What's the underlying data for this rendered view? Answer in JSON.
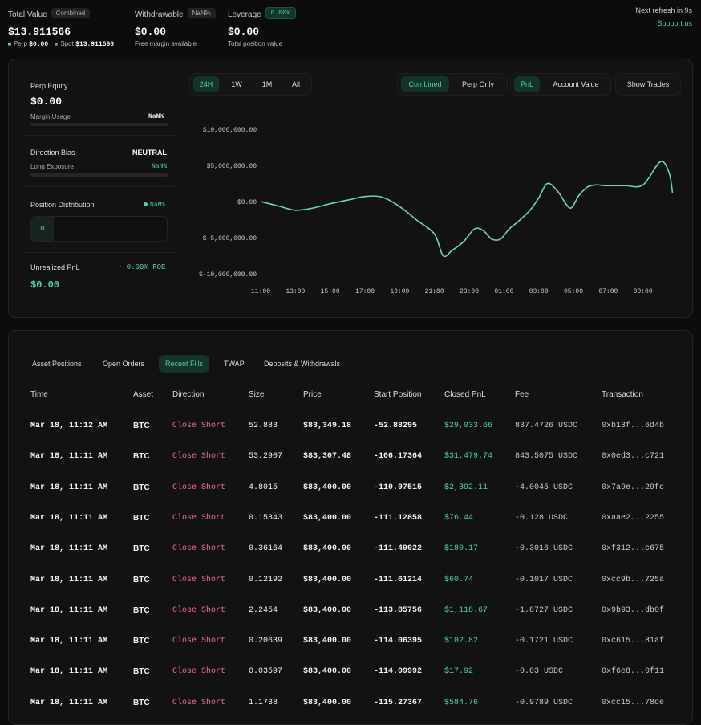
{
  "top": {
    "total_value": {
      "label": "Total Value",
      "pill": "Combined",
      "value": "$13.911566",
      "perp_label": "Perp",
      "perp_value": "$0.00",
      "spot_label": "Spot",
      "spot_value": "$13.911566"
    },
    "withdrawable": {
      "label": "Withdrawable",
      "pill": "NaN%",
      "value": "$0.00",
      "sub": "Free margin available"
    },
    "leverage": {
      "label": "Leverage",
      "pill": "0.00x",
      "value": "$0.00",
      "sub": "Total position value"
    },
    "refresh": "Next refresh in 9s",
    "support": "Support us"
  },
  "summary": {
    "perp_equity_label": "Perp Equity",
    "perp_equity_value": "$0.00",
    "margin_usage_label": "Margin Usage",
    "margin_usage_value": "NaN%",
    "direction_bias_label": "Direction Bias",
    "direction_bias_value": "NEUTRAL",
    "long_exposure_label": "Long Exposure",
    "long_exposure_value": "NaN%",
    "position_distribution_label": "Position Distribution",
    "position_distribution_value": "NaN%",
    "position_count": "0",
    "unrealized_pnl_label": "Unrealized PnL",
    "roe_value": "↑ 0.00% ROE",
    "unrealized_pnl_value": "$0.00"
  },
  "chart_controls": {
    "ranges": [
      "24H",
      "1W",
      "1M",
      "All"
    ],
    "active_range": "24H",
    "modes": [
      "Combined",
      "Perp Only"
    ],
    "metrics": [
      "PnL",
      "Account Value"
    ],
    "show_trades": "Show Trades",
    "colors": {
      "accent": "#4fd1a5",
      "line": "#66d9b2"
    }
  },
  "chart_data": {
    "type": "line",
    "title": "",
    "xlabel": "",
    "ylabel": "",
    "yticks": [
      "$10,000,000.00",
      "$5,000,000.00",
      "$0.00",
      "$-5,000,000.00",
      "$-10,000,000.00"
    ],
    "ylim": [
      -10000000,
      10000000
    ],
    "xticks": [
      "11:00",
      "13:00",
      "15:00",
      "17:00",
      "19:00",
      "21:00",
      "23:00",
      "01:00",
      "03:00",
      "05:00",
      "07:00",
      "09:00"
    ],
    "x": [
      0,
      1.0,
      2.0,
      3.0,
      4.0,
      5.0,
      6.0,
      7.0,
      8.0,
      9.0,
      10.0,
      10.5,
      11.0,
      11.7,
      12.3,
      12.8,
      13.3,
      13.8,
      14.3,
      14.8,
      15.5,
      16.0,
      16.5,
      17.1,
      17.8,
      18.3,
      18.8,
      19.3,
      19.8,
      20.4,
      21.0,
      22.0,
      23.0,
      23.5,
      23.7
    ],
    "values": [
      0,
      -600000,
      -1200000,
      -900000,
      -300000,
      200000,
      700000,
      600000,
      -700000,
      -2600000,
      -4500000,
      -7500000,
      -6800000,
      -5500000,
      -3800000,
      -4000000,
      -5200000,
      -5200000,
      -3800000,
      -2800000,
      -1200000,
      500000,
      2500000,
      1400000,
      -900000,
      800000,
      2000000,
      2300000,
      2200000,
      2200000,
      2200000,
      2300000,
      5500000,
      4000000,
      1200000
    ],
    "grid": false,
    "legend": "none"
  },
  "tabs": [
    "Asset Positions",
    "Open Orders",
    "Recent Fills",
    "TWAP",
    "Deposits & Withdrawals"
  ],
  "active_tab": "Recent Fills",
  "table": {
    "headers": [
      "Time",
      "Asset",
      "Direction",
      "Size",
      "Price",
      "Start Position",
      "Closed PnL",
      "Fee",
      "Transaction"
    ],
    "rows": [
      [
        "Mar 18, 11:12 AM",
        "BTC",
        "Close Short",
        "52.883",
        "$83,349.18",
        "-52.88295",
        "$29,033.66",
        "837.4726 USDC",
        "0xb13f...6d4b"
      ],
      [
        "Mar 18, 11:11 AM",
        "BTC",
        "Close Short",
        "53.2907",
        "$83,307.48",
        "-106.17364",
        "$31,479.74",
        "843.5075 USDC",
        "0x0ed3...c721"
      ],
      [
        "Mar 18, 11:11 AM",
        "BTC",
        "Close Short",
        "4.8015",
        "$83,400.00",
        "-110.97515",
        "$2,392.11",
        "-4.0045 USDC",
        "0x7a9e...29fc"
      ],
      [
        "Mar 18, 11:11 AM",
        "BTC",
        "Close Short",
        "0.15343",
        "$83,400.00",
        "-111.12858",
        "$76.44",
        "-0.128 USDC",
        "0xaae2...2255"
      ],
      [
        "Mar 18, 11:11 AM",
        "BTC",
        "Close Short",
        "0.36164",
        "$83,400.00",
        "-111.49022",
        "$180.17",
        "-0.3016 USDC",
        "0xf312...c675"
      ],
      [
        "Mar 18, 11:11 AM",
        "BTC",
        "Close Short",
        "0.12192",
        "$83,400.00",
        "-111.61214",
        "$60.74",
        "-0.1017 USDC",
        "0xcc9b...725a"
      ],
      [
        "Mar 18, 11:11 AM",
        "BTC",
        "Close Short",
        "2.2454",
        "$83,400.00",
        "-113.85756",
        "$1,118.67",
        "-1.8727 USDC",
        "0x9b93...db0f"
      ],
      [
        "Mar 18, 11:11 AM",
        "BTC",
        "Close Short",
        "0.20639",
        "$83,400.00",
        "-114.06395",
        "$102.82",
        "-0.1721 USDC",
        "0xc615...81af"
      ],
      [
        "Mar 18, 11:11 AM",
        "BTC",
        "Close Short",
        "0.03597",
        "$83,400.00",
        "-114.09992",
        "$17.92",
        "-0.03 USDC",
        "0xf6e8...0f11"
      ],
      [
        "Mar 18, 11:11 AM",
        "BTC",
        "Close Short",
        "1.1738",
        "$83,400.00",
        "-115.27367",
        "$584.76",
        "-0.9789 USDC",
        "0xcc15...78de"
      ]
    ]
  }
}
